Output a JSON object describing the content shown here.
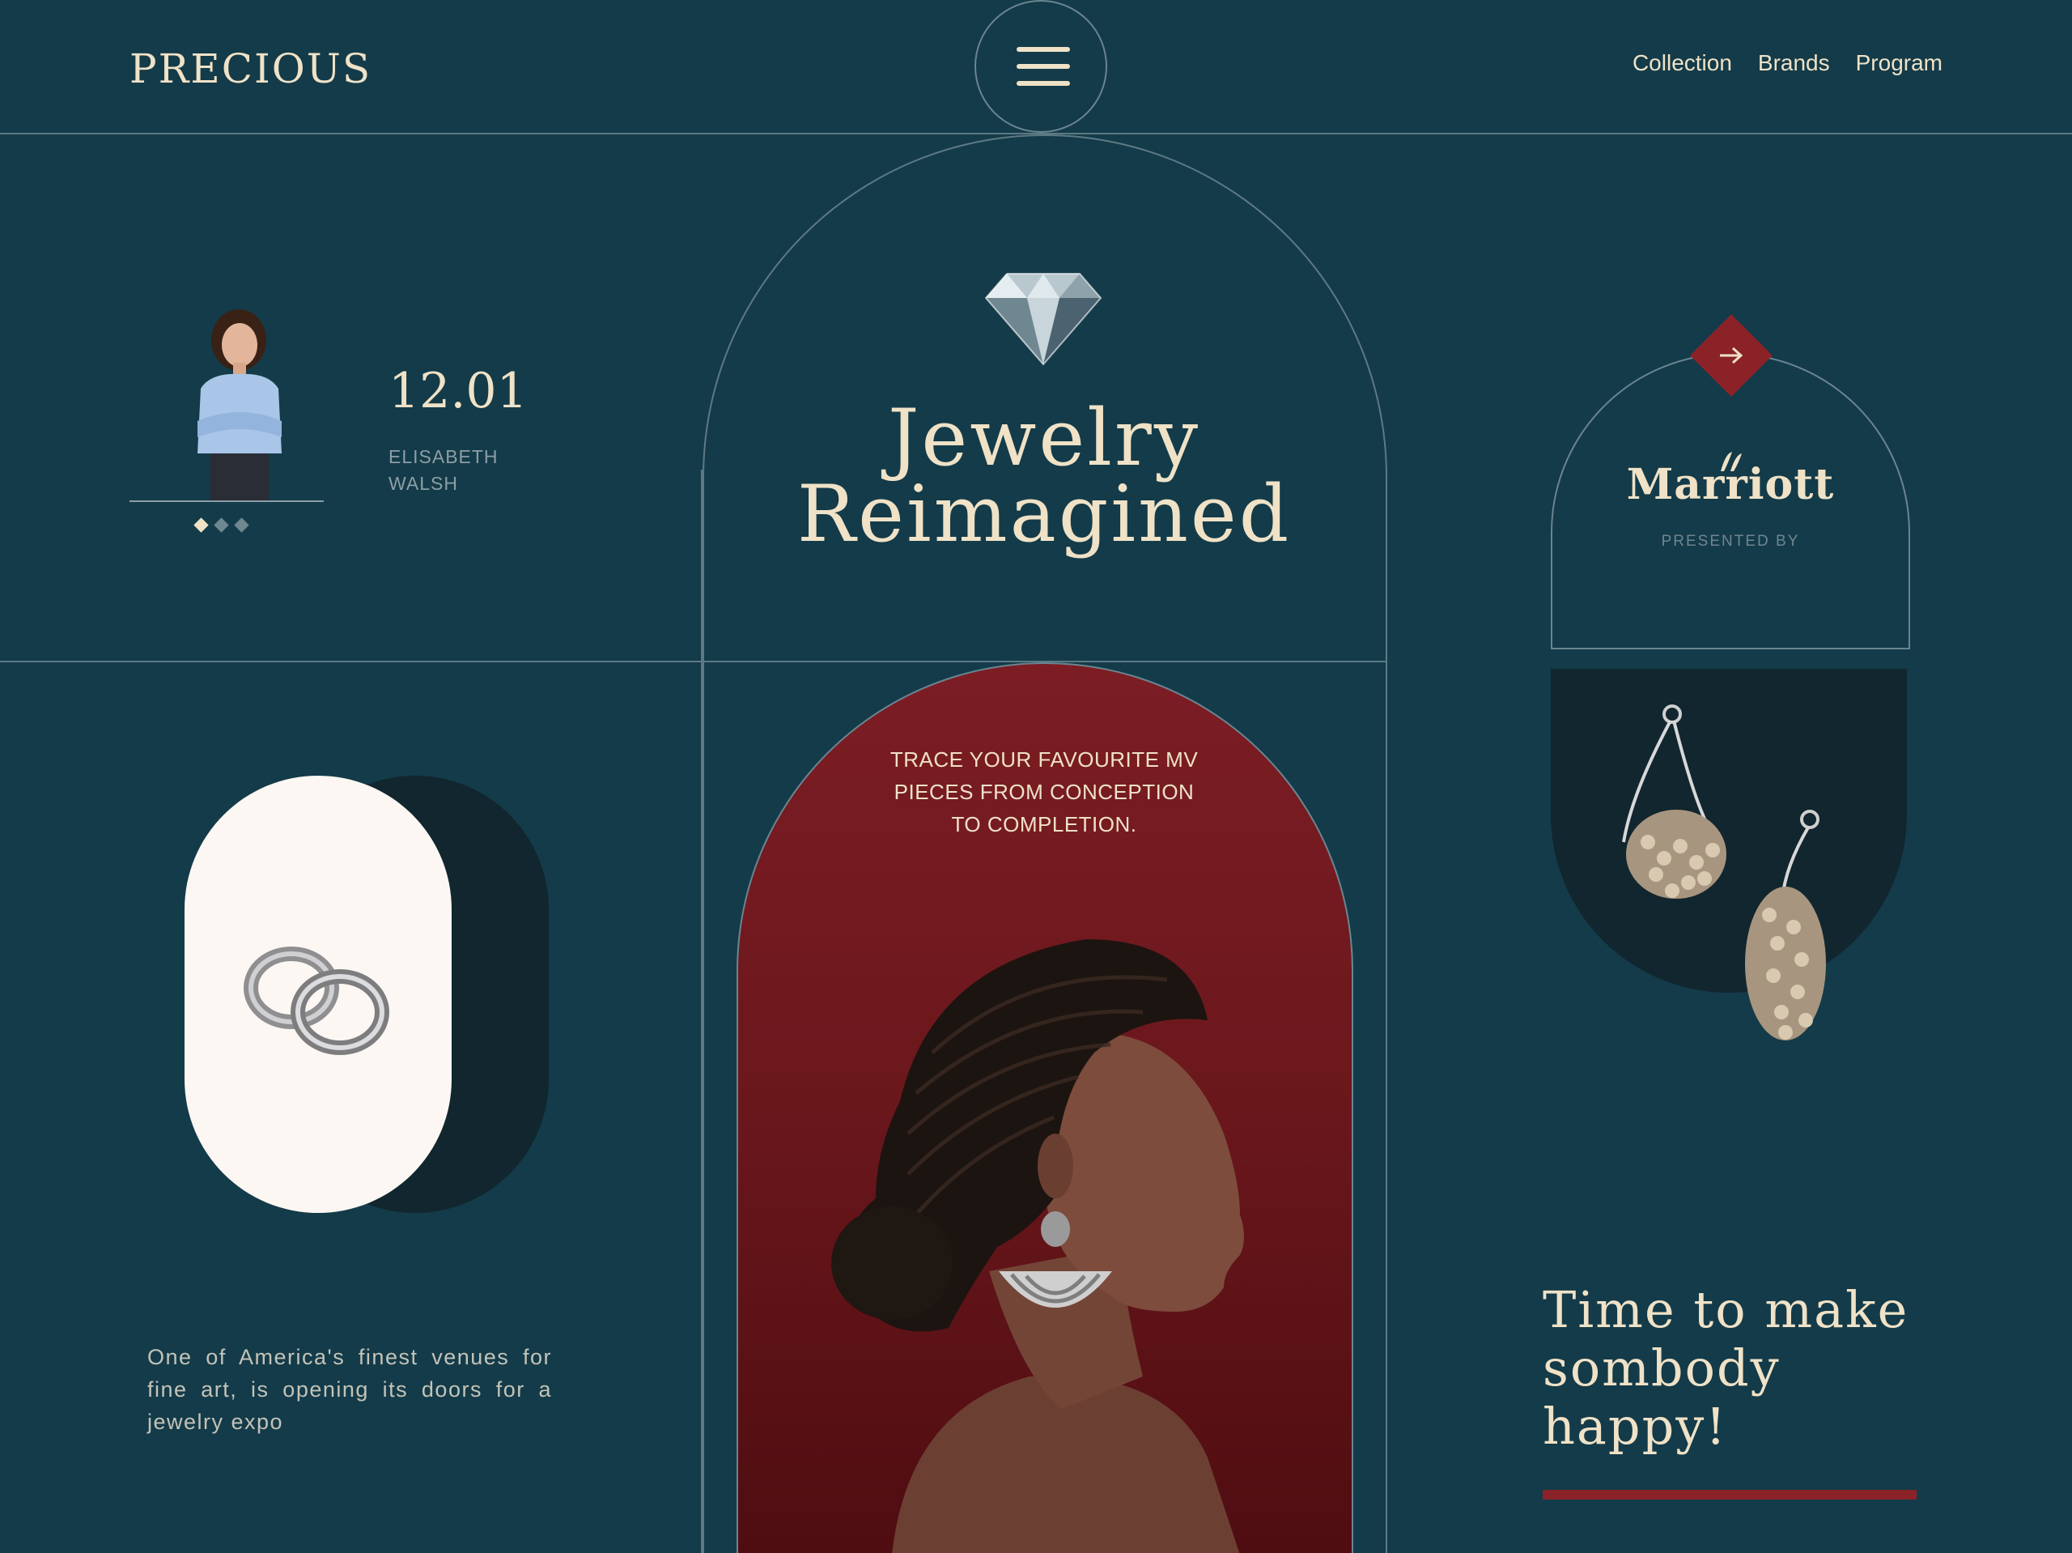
{
  "brand": {
    "logo": "PRECIOUS"
  },
  "header": {
    "menu_icon": "hamburger-menu-icon",
    "nav": [
      "Collection",
      "Brands",
      "Program"
    ]
  },
  "event": {
    "date": "12.01",
    "speaker_first": "ELISABETH",
    "speaker_last": "WALSH",
    "carousel_dots": 3,
    "active_dot": 0
  },
  "hero": {
    "title_line1": "Jewelry",
    "title_line2": "Reimagined",
    "icon": "diamond-icon"
  },
  "sponsor": {
    "name": "Marriott",
    "caption": "PRESENTED BY",
    "arrow_icon": "arrow-right-icon"
  },
  "feature": {
    "trace_text": "TRACE YOUR FAVOURITE MV PIECES FROM CONCEPTION TO COMPLETION."
  },
  "intro": {
    "blurb": "One of America's finest venues for fine art, is opening its doors for a jewelry expo"
  },
  "cta": {
    "tagline_line1": "Time to make",
    "tagline_line2": "sombody",
    "tagline_line3": "happy!"
  },
  "colors": {
    "background": "#143b49",
    "cream": "#efe2c7",
    "accent_red": "#8b2228",
    "dark_panel": "#11262e",
    "pill": "#fcf7f2"
  }
}
